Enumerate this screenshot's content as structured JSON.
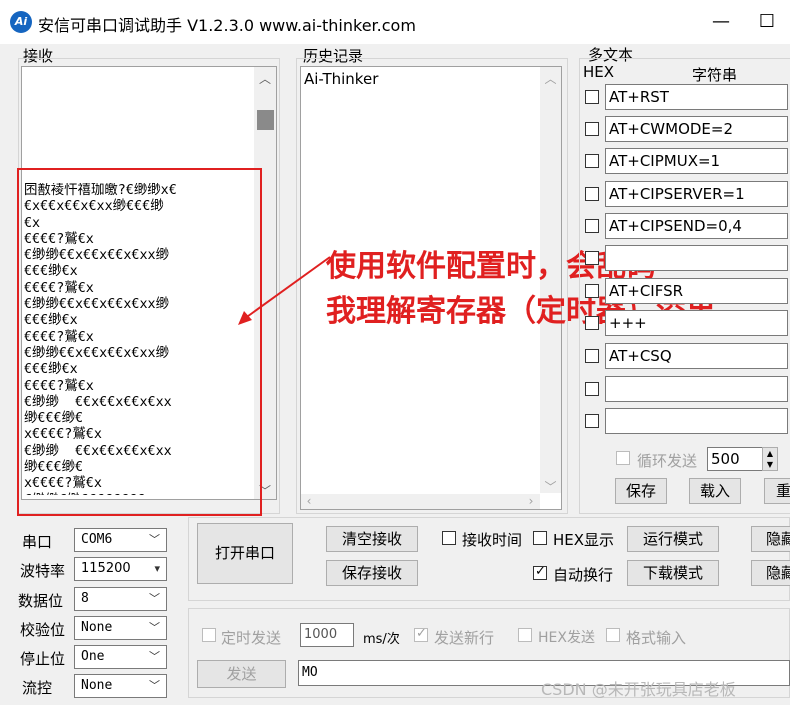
{
  "window": {
    "title": "安信可串口调试助手 V1.2.3.0    www.ai-thinker.com",
    "icon_text": "Ai"
  },
  "receive": {
    "label": "接收",
    "garbled_text": "囨敾裬忓禧珈皦?€缈缈x€\n€x€€x€€x€xx缈€€€缈\n€x\n€€€€?鷲€x\n€缈缈€€x€€x€€x€xx缈\n€€€缈€x\n€€€€?鷲€x\n€缈缈€€x€€x€€x€xx缈\n€€€缈€x\n€€€€?鷲€x\n€缈缈€€x€€x€€x€xx缈\n€€€缈€x\n€€€€?鷲€x\n€缈缈  €€x€€x€€x€xx\n缈€€€缈€\nx€€€€?鷲€x\n€缈缈  €€x€€x€€x€xx\n缈€€€缈€\nx€€€€?鷲€x\n€缈缈€缈€€€€€€€€"
  },
  "history": {
    "label": "历史记录",
    "items": [
      "Ai-Thinker"
    ]
  },
  "multi": {
    "label": "多文本",
    "hex_label": "HEX",
    "str_label": "字符串",
    "rows": [
      "AT+RST",
      "AT+CWMODE=2",
      "AT+CIPMUX=1",
      "AT+CIPSERVER=1",
      "AT+CIPSEND=0,4",
      "",
      "AT+CIFSR",
      "+++",
      "AT+CSQ",
      "",
      ""
    ],
    "loop_label": "循环发送",
    "loop_value": "500",
    "save_label": "保存",
    "load_label": "载入",
    "reset_label": "重"
  },
  "annotation": {
    "line1": "使用软件配置时，会乱码",
    "line2": "我理解寄存器（定时器）溢出"
  },
  "serial": {
    "port_label": "串口",
    "port_value": "COM6",
    "baud_label": "波特率",
    "baud_value": "115200",
    "data_label": "数据位",
    "data_value": "8",
    "parity_label": "校验位",
    "parity_value": "None",
    "stop_label": "停止位",
    "stop_value": "One",
    "flow_label": "流控",
    "flow_value": "None"
  },
  "controls": {
    "open_port": "打开串口",
    "clear_receive": "清空接收",
    "save_receive": "保存接收",
    "receive_time": "接收时间",
    "hex_display": "HEX显示",
    "auto_wrap": "自动换行",
    "run_mode": "运行模式",
    "download_mode": "下载模式",
    "hide1": "隐藏",
    "hide2": "隐藏"
  },
  "send": {
    "timed_send": "定时发送",
    "interval_value": "1000",
    "interval_unit": "ms/次",
    "send_newline": "发送新行",
    "hex_send": "HEX发送",
    "format_input": "格式输入",
    "send_button": "发送",
    "send_text": "MO"
  },
  "watermark": "CSDN @未开张玩具店老板"
}
